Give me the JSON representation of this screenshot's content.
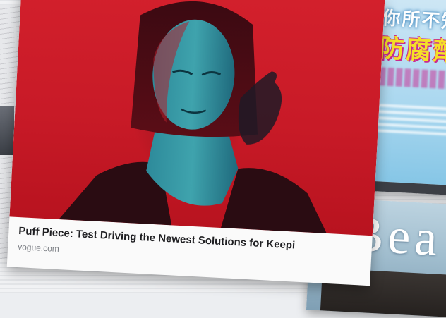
{
  "article_card": {
    "headline": "Puff Piece: Test Driving the Newest Solutions for Keepi",
    "source": "vogue.com",
    "photo_icon": "portrait-photo"
  },
  "ad_top_right": {
    "line1": "你所不知",
    "line2": "防腐劑"
  },
  "ad_bottom_right": {
    "word": "Bea"
  },
  "colors": {
    "photo_red": "#c81a27",
    "caption_text": "#1f1f22",
    "source_text": "#7a7d83",
    "cn_headline_yellow": "#f5e028"
  }
}
